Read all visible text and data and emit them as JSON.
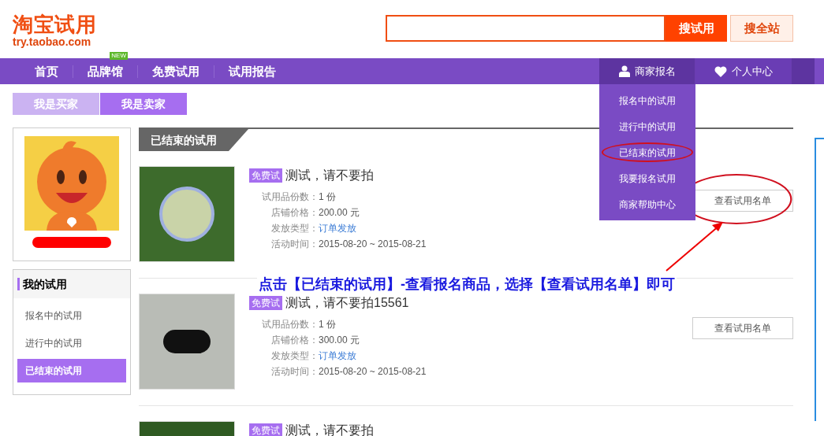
{
  "logo": {
    "title": "淘宝试用",
    "url": "try.taobao.com"
  },
  "search": {
    "buttons": [
      {
        "label": "搜试用",
        "kind": "primary"
      },
      {
        "label": "搜全站",
        "kind": "secondary"
      }
    ]
  },
  "nav": {
    "items": [
      {
        "label": "首页"
      },
      {
        "label": "品牌馆",
        "badge": "NEW"
      },
      {
        "label": "免费试用"
      },
      {
        "label": "试用报告"
      }
    ],
    "right": [
      {
        "label": "商家报名",
        "expanded": true
      },
      {
        "label": "个人中心",
        "expanded": false
      }
    ]
  },
  "dropdown": {
    "items": [
      {
        "label": "报名中的试用",
        "circled": false
      },
      {
        "label": "进行中的试用",
        "circled": false
      },
      {
        "label": "已结束的试用",
        "circled": true
      },
      {
        "label": "我要报名试用",
        "circled": false
      },
      {
        "label": "商家帮助中心",
        "circled": false
      }
    ]
  },
  "role_tabs": [
    {
      "label": "我是买家",
      "selected": false
    },
    {
      "label": "我是卖家",
      "selected": true
    }
  ],
  "sidebar": {
    "title": "我的试用",
    "items": [
      {
        "label": "报名中的试用",
        "selected": false
      },
      {
        "label": "进行中的试用",
        "selected": false
      },
      {
        "label": "已结束的试用",
        "selected": true
      }
    ]
  },
  "section_title": "已结束的试用",
  "products": [
    {
      "badge": "免费试",
      "title": "测试，请不要拍",
      "fields": [
        {
          "label": "试用品份数：",
          "value": "1 份",
          "kind": "text"
        },
        {
          "label": "店铺价格：",
          "value": "200.00 元",
          "kind": "text"
        },
        {
          "label": "发放类型：",
          "value": "订单发放",
          "kind": "link"
        },
        {
          "label": "活动时间：",
          "value": "2015-08-20 ~ 2015-08-21",
          "kind": "text"
        }
      ],
      "button": "查看试用名单",
      "button_circled": true
    },
    {
      "badge": "免费试",
      "title": "测试，请不要拍15561",
      "fields": [
        {
          "label": "试用品份数：",
          "value": "1 份",
          "kind": "text"
        },
        {
          "label": "店铺价格：",
          "value": "300.00 元",
          "kind": "text"
        },
        {
          "label": "发放类型：",
          "value": "订单发放",
          "kind": "link"
        },
        {
          "label": "活动时间：",
          "value": "2015-08-20 ~ 2015-08-21",
          "kind": "text"
        }
      ],
      "button": "查看试用名单",
      "button_circled": false
    },
    {
      "badge": "免费试",
      "title": "测试，请不要拍"
    }
  ],
  "annotation": "点击【已结束的试用】-查看报名商品，选择【查看试用名单】即可"
}
